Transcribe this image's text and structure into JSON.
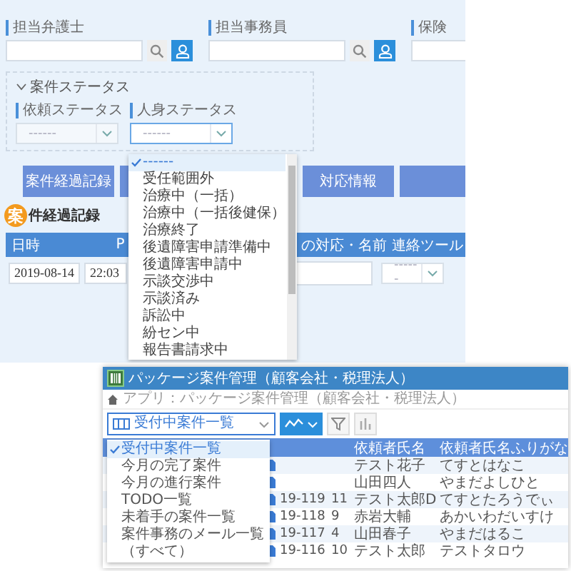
{
  "case_panel": {
    "fields": [
      {
        "label": "担当弁護士"
      },
      {
        "label": "担当事務員"
      },
      {
        "label": "保険"
      }
    ],
    "status_section": {
      "title": "案件ステータス",
      "expanded": true,
      "selects": [
        {
          "label": "依頼ステータス",
          "value": "------",
          "focused": false
        },
        {
          "label": "人身ステータス",
          "value": "------",
          "focused": true
        }
      ]
    },
    "status_dropdown": {
      "options": [
        {
          "label": "------",
          "selected": true
        },
        {
          "label": "受任範囲外",
          "selected": false
        },
        {
          "label": "治療中（一括）",
          "selected": false
        },
        {
          "label": "治療中（一括後健保）",
          "selected": false
        },
        {
          "label": "治療終了",
          "selected": false
        },
        {
          "label": "後遺障害申請準備中",
          "selected": false
        },
        {
          "label": "後遺障害申請中",
          "selected": false
        },
        {
          "label": "示談交渉中",
          "selected": false
        },
        {
          "label": "示談済み",
          "selected": false
        },
        {
          "label": "訴訟中",
          "selected": false
        },
        {
          "label": "紛セン中",
          "selected": false
        },
        {
          "label": "報告書請求中",
          "selected": false
        }
      ]
    },
    "buttons": [
      {
        "kind": "text",
        "label": "案件経過記録"
      },
      {
        "kind": "blank"
      },
      {
        "kind": "text",
        "label": "対応情報"
      },
      {
        "kind": "blank"
      }
    ],
    "section_heading": {
      "badge": "案",
      "title": "件経過記録"
    },
    "table": {
      "columns": [
        "日時",
        "P",
        "の対応・名前",
        "連絡ツール"
      ],
      "row": {
        "date": "2019-08-14",
        "time": "22:03",
        "tool": "------"
      }
    }
  },
  "app_window": {
    "title": "パッケージ案件管理（顧客会社・税理法人）",
    "breadcrumb": "アプリ：パッケージ案件管理（顧客会社・税理法人）",
    "view_select": "受付中案件一覧",
    "view_options": [
      {
        "label": "受付中案件一覧",
        "selected": true
      },
      {
        "label": "今月の完了案件",
        "selected": false
      },
      {
        "label": "今月の進行案件",
        "selected": false
      },
      {
        "label": "TODO一覧",
        "selected": false
      },
      {
        "label": "未着手の案件一覧",
        "selected": false
      },
      {
        "label": "案件事務のメール一覧",
        "selected": false
      },
      {
        "label": "（すべて）",
        "selected": false
      }
    ],
    "table": {
      "columns": [
        "依頼者氏名",
        "依頼者氏名ふりがな"
      ],
      "rows": [
        {
          "name": "テスト花子",
          "kana": "てすとはなこ"
        },
        {
          "name": "山田四人",
          "kana": "やまだよしひと"
        },
        {
          "id": "19-119",
          "num": "11",
          "name": "テスト太郎D",
          "kana": "てすとたろうでぃ"
        },
        {
          "id": "19-118",
          "num": "9",
          "name": "赤岩大輔",
          "kana": "あかいわだいすけ"
        },
        {
          "id": "19-117",
          "num": "4",
          "name": "山田春子",
          "kana": "やまだはるこ"
        },
        {
          "id": "19-116",
          "num": "10",
          "name": "テスト太郎",
          "kana": "テストタロウ"
        }
      ]
    }
  }
}
